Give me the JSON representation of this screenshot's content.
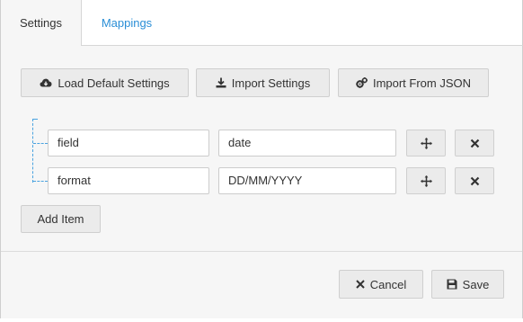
{
  "tabs": [
    {
      "label": "Settings",
      "active": true
    },
    {
      "label": "Mappings",
      "active": false
    }
  ],
  "toolbar": {
    "load_default_label": "Load Default Settings",
    "import_settings_label": "Import Settings",
    "import_json_label": "Import From JSON"
  },
  "rows": [
    {
      "key": "field",
      "value": "date"
    },
    {
      "key": "format",
      "value": "DD/MM/YYYY"
    }
  ],
  "add_item_label": "Add Item",
  "footer": {
    "cancel_label": "Cancel",
    "save_label": "Save"
  },
  "colors": {
    "accent": "#2a8ed6",
    "tree_line": "#4aa3e0",
    "panel_bg": "#f6f6f6",
    "button_bg": "#ebebeb"
  },
  "icons": {
    "load_default": "cloud-download-icon",
    "import_settings": "download-icon",
    "import_json": "cogs-icon",
    "move": "move-icon",
    "remove": "close-icon",
    "cancel": "close-icon",
    "save": "floppy-disk-icon"
  }
}
